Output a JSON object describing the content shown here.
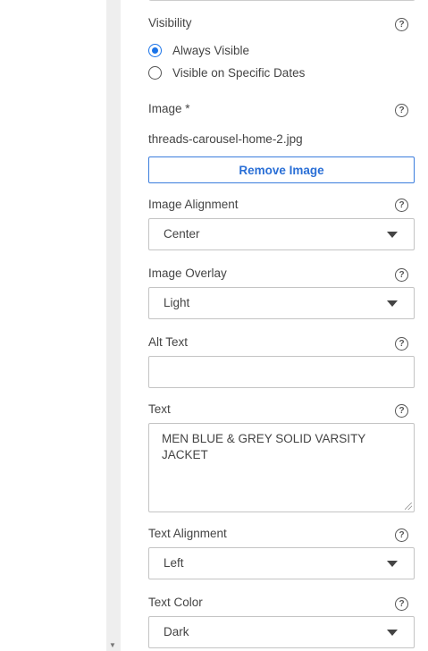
{
  "visibility": {
    "label": "Visibility",
    "options": [
      {
        "label": "Always Visible",
        "checked": true
      },
      {
        "label": "Visible on Specific Dates",
        "checked": false
      }
    ]
  },
  "image": {
    "label": "Image *",
    "filename": "threads-carousel-home-2.jpg",
    "remove_button": "Remove Image"
  },
  "image_alignment": {
    "label": "Image Alignment",
    "value": "Center"
  },
  "image_overlay": {
    "label": "Image Overlay",
    "value": "Light"
  },
  "alt_text": {
    "label": "Alt Text",
    "value": ""
  },
  "text": {
    "label": "Text",
    "value": "MEN BLUE & GREY SOLID VARSITY JACKET"
  },
  "text_alignment": {
    "label": "Text Alignment",
    "value": "Left"
  },
  "text_color": {
    "label": "Text Color",
    "value": "Dark"
  },
  "help_glyph": "?",
  "scroll_glyph": "▼",
  "colors": {
    "accent": "#1a73e8",
    "button_text": "#2a6fd6",
    "strip": "#eeeeee"
  }
}
